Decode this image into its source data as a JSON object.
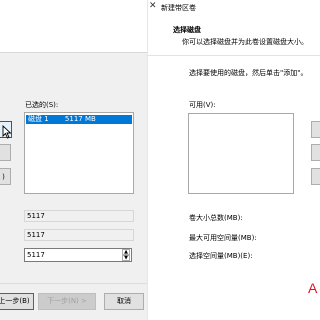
{
  "left_dialog": {
    "selected_label": "已选的(S):",
    "selected_items": [
      {
        "name": "磁盘 1",
        "size": "5117 MB"
      }
    ],
    "btn_fragment": ")",
    "total_value": "5117",
    "max_value": "5117",
    "space_value": "5117",
    "buttons": {
      "back": "上一步(B)",
      "next": "下一步(N) >",
      "cancel": "取消"
    }
  },
  "right_dialog": {
    "title": "新建带区卷",
    "heading": "选择磁盘",
    "subtitle": "你可以选择磁盘并为此卷设置磁盘大小。",
    "instruction": "选择要使用的磁盘，然后单击\"添加\"。",
    "available_label": "可用(V):",
    "total_size_label": "卷大小总数(MB):",
    "max_space_label": "最大可用空间量(MB):",
    "select_space_label": "选择空间量(MB)(E):",
    "corner_mark": "A"
  },
  "colors": {
    "selection": "#0078d7",
    "focus_border": "#e81123",
    "window_bg": "#f0f0f0"
  },
  "icons": [
    "close-icon",
    "mouse-cursor-icon",
    "spin-up-icon",
    "spin-down-icon"
  ]
}
